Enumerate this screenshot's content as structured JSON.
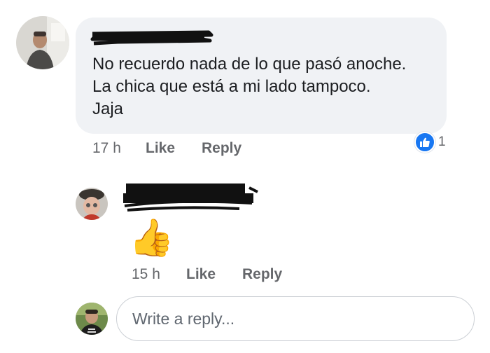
{
  "comment": {
    "lines": [
      "No recuerdo nada de lo que pasó anoche.",
      "La chica que está a mi lado tampoco.",
      "Jaja"
    ],
    "time": "17 h",
    "like_label": "Like",
    "reply_label": "Reply",
    "reaction_icon": "thumbs-up-icon",
    "reaction_count": "1"
  },
  "reply": {
    "emoji": "👍",
    "time": "15 h",
    "like_label": "Like",
    "reply_label": "Reply"
  },
  "composer": {
    "placeholder": "Write a reply..."
  },
  "colors": {
    "bubble": "#f0f2f5",
    "meta_text": "#65676b",
    "like_blue": "#1877f2",
    "input_border": "#ccd0d5"
  }
}
